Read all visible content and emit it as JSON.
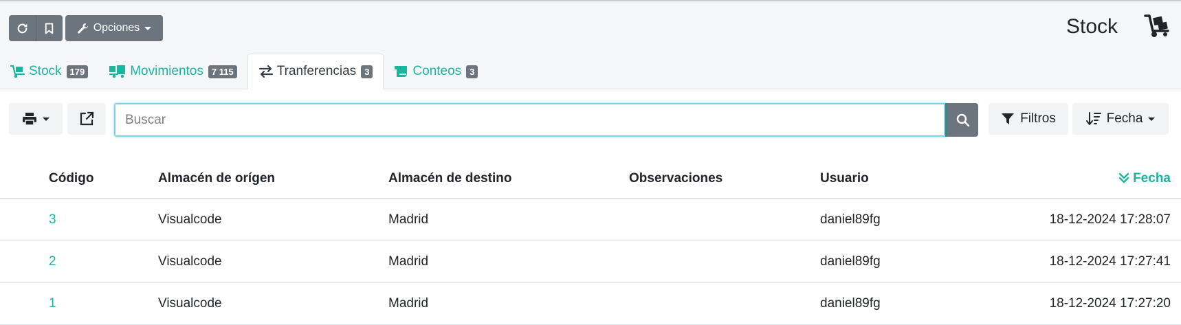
{
  "header": {
    "options_label": "Opciones",
    "page_title": "Stock"
  },
  "tabs": [
    {
      "label": "Stock",
      "count": "179",
      "icon": "dolly-icon",
      "active": false
    },
    {
      "label": "Movimientos",
      "count": "7 115",
      "icon": "truck-loading-icon",
      "active": false
    },
    {
      "label": "Tranferencias",
      "count": "3",
      "icon": "exchange-icon",
      "active": true
    },
    {
      "label": "Conteos",
      "count": "3",
      "icon": "scroll-icon",
      "active": false
    }
  ],
  "toolbar": {
    "search_placeholder": "Buscar",
    "filters_label": "Filtros",
    "sort_label": "Fecha"
  },
  "table": {
    "headers": {
      "code": "Código",
      "origin": "Almacén de orígen",
      "destination": "Almacén de destino",
      "observations": "Observaciones",
      "user": "Usuario",
      "date": "Fecha"
    },
    "rows": [
      {
        "code": "3",
        "origin": "Visualcode",
        "destination": "Madrid",
        "observations": "",
        "user": "daniel89fg",
        "date": "18-12-2024 17:28:07"
      },
      {
        "code": "2",
        "origin": "Visualcode",
        "destination": "Madrid",
        "observations": "",
        "user": "daniel89fg",
        "date": "18-12-2024 17:27:41"
      },
      {
        "code": "1",
        "origin": "Visualcode",
        "destination": "Madrid",
        "observations": "",
        "user": "daniel89fg",
        "date": "18-12-2024 17:27:20"
      }
    ]
  },
  "colors": {
    "accent": "#18b59f",
    "button_dark": "#6c757d",
    "header_bg": "#f5f6f8"
  }
}
